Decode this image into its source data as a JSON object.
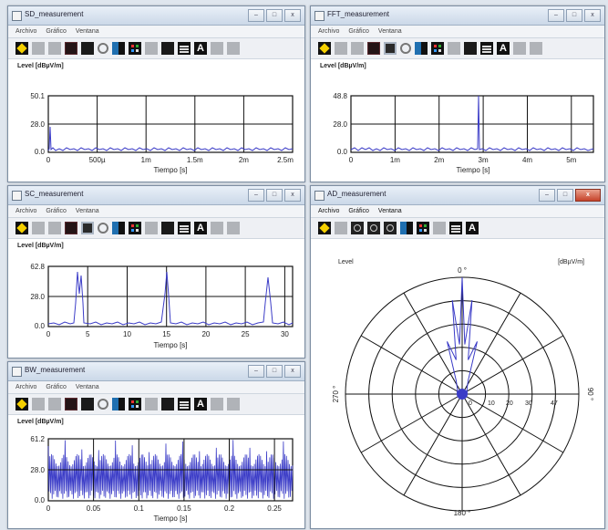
{
  "windows": [
    {
      "id": "sd",
      "title": "SD_measurement",
      "menu": [
        "Archivo",
        "Gráfico",
        "Ventana"
      ],
      "ylabel": "Level [dBµV/m]",
      "xlabel": "Tiempo [s]",
      "ytick_labels": [
        "50.1",
        "28.0",
        "0.0"
      ],
      "xtick_labels": [
        "0",
        "500µ",
        "1m",
        "1.5m",
        "2m",
        "2.5m"
      ]
    },
    {
      "id": "fft",
      "title": "FFT_measurement",
      "menu": [
        "Archivo",
        "Gráfico",
        "Ventana"
      ],
      "ylabel": "Level [dBµV/m]",
      "xlabel": "Tiempo [s]",
      "ytick_labels": [
        "48.8",
        "28.0",
        "0.0"
      ],
      "xtick_labels": [
        "0",
        "1m",
        "2m",
        "3m",
        "4m",
        "5m"
      ]
    },
    {
      "id": "sc",
      "title": "SC_measurement",
      "menu": [
        "Archivo",
        "Gráfico",
        "Ventana"
      ],
      "ylabel": "Level [dBµV/m]",
      "xlabel": "Tiempo [s]",
      "ytick_labels": [
        "62.8",
        "28.0",
        "0.0"
      ],
      "xtick_labels": [
        "0",
        "5",
        "10",
        "15",
        "20",
        "25",
        "30"
      ]
    },
    {
      "id": "bw",
      "title": "BW_measurement",
      "menu": [
        "Archivo",
        "Gráfico",
        "Ventana"
      ],
      "ylabel": "Level [dBµV/m]",
      "xlabel": "Tiempo [s]",
      "ytick_labels": [
        "61.2",
        "28.0",
        "0.0"
      ],
      "xtick_labels": [
        "0",
        "0.05",
        "0.1",
        "0.15",
        "0.2",
        "0.25"
      ]
    },
    {
      "id": "ad",
      "title": "AD_measurement",
      "menu": [
        "Archivo",
        "Gráfico",
        "Ventana"
      ],
      "level_label": "Level",
      "unit_label": "[dBµV/m]",
      "angle_top": "0 °",
      "angle_left": "270 °",
      "angle_right": "90 °",
      "angle_bottom": "180 °",
      "radial_labels": [
        "0",
        "10",
        "20",
        "30",
        "47"
      ]
    }
  ],
  "chart_data": [
    {
      "type": "line",
      "window": "SD_measurement",
      "ylabel": "Level [dBµV/m]",
      "xlabel": "Tiempo [s]",
      "xlim": [
        0,
        0.0025
      ],
      "ylim": [
        0,
        50.1
      ],
      "series": [
        {
          "x": [
            0,
            3e-05,
            5e-05,
            0.0001,
            0.0005,
            0.001,
            0.0015,
            0.002,
            0.0025
          ],
          "y": [
            2,
            22,
            3,
            2,
            2,
            2,
            2,
            2,
            2
          ]
        }
      ]
    },
    {
      "type": "line",
      "window": "FFT_measurement",
      "ylabel": "Level [dBµV/m]",
      "xlabel": "Tiempo [s]",
      "xlim": [
        0,
        0.0055
      ],
      "ylim": [
        0,
        48.8
      ],
      "series": [
        {
          "x": [
            0,
            0.001,
            0.002,
            0.0029,
            0.00295,
            0.003,
            0.004,
            0.005,
            0.0055
          ],
          "y": [
            2,
            2,
            2,
            2,
            48,
            2,
            2,
            2,
            2
          ]
        }
      ]
    },
    {
      "type": "line",
      "window": "SC_measurement",
      "ylabel": "Level [dBµV/m]",
      "xlabel": "Tiempo [s]",
      "xlim": [
        0,
        31
      ],
      "ylim": [
        0,
        62.8
      ],
      "series": [
        {
          "x": [
            0,
            3,
            3.5,
            4,
            4.5,
            5,
            14.5,
            15.5,
            16.5,
            28,
            29,
            30,
            31
          ],
          "y": [
            3,
            3,
            55,
            30,
            48,
            3,
            3,
            55,
            3,
            3,
            45,
            3,
            3
          ]
        }
      ]
    },
    {
      "type": "line",
      "window": "BW_measurement",
      "ylabel": "Level [dBµV/m]",
      "xlabel": "Tiempo [s]",
      "xlim": [
        0,
        0.27
      ],
      "ylim": [
        0,
        61.2
      ],
      "series": [
        {
          "pattern": "dense oscillation between approx 5 and 45, peaks near 58"
        }
      ]
    },
    {
      "type": "line",
      "window": "AD_measurement",
      "subtype": "polar",
      "rlim": [
        0,
        47
      ],
      "series": [
        {
          "angle_deg": [
            0,
            10,
            20,
            340,
            350
          ],
          "r": [
            47,
            30,
            12,
            12,
            30
          ]
        }
      ]
    }
  ]
}
